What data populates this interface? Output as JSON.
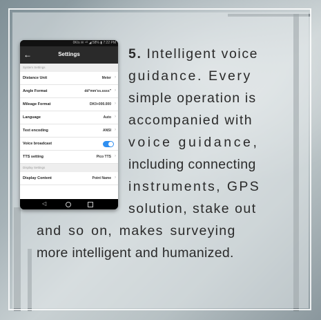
{
  "phone": {
    "status_text": "0K/s ✉ ⁴ᴳ ◢ 58% ▮ 7:22 PM",
    "title": "Settings",
    "sections": {
      "system": "System Settings",
      "display": "Display Settings"
    },
    "rows": [
      {
        "label": "Distance Unit",
        "value": "Meter"
      },
      {
        "label": "Angle Format",
        "value": "dd°mm'ss.ssss\""
      },
      {
        "label": "Mileage Format",
        "value": "DK0+000.000"
      },
      {
        "label": "Language",
        "value": "Auto"
      },
      {
        "label": "Text encoding",
        "value": "ANSI"
      },
      {
        "label": "Voice broadcast",
        "value": "on"
      },
      {
        "label": "TTS setting",
        "value": "Pico TTS"
      },
      {
        "label": "Display Content",
        "value": "Point Name"
      }
    ]
  },
  "description": {
    "number": "5.",
    "lines": [
      "Intelligent voice",
      "guidance. Every",
      "simple operation is",
      "accompanied with",
      "voice guidance,",
      "including connecting",
      "instruments, GPS",
      "solution, stake out",
      "and so on, makes surveying",
      "more intelligent and humanized."
    ]
  },
  "colors": {
    "toggle_on": "#2f8ff0",
    "text": "#2a2a2a",
    "frame": "#ffffff"
  }
}
